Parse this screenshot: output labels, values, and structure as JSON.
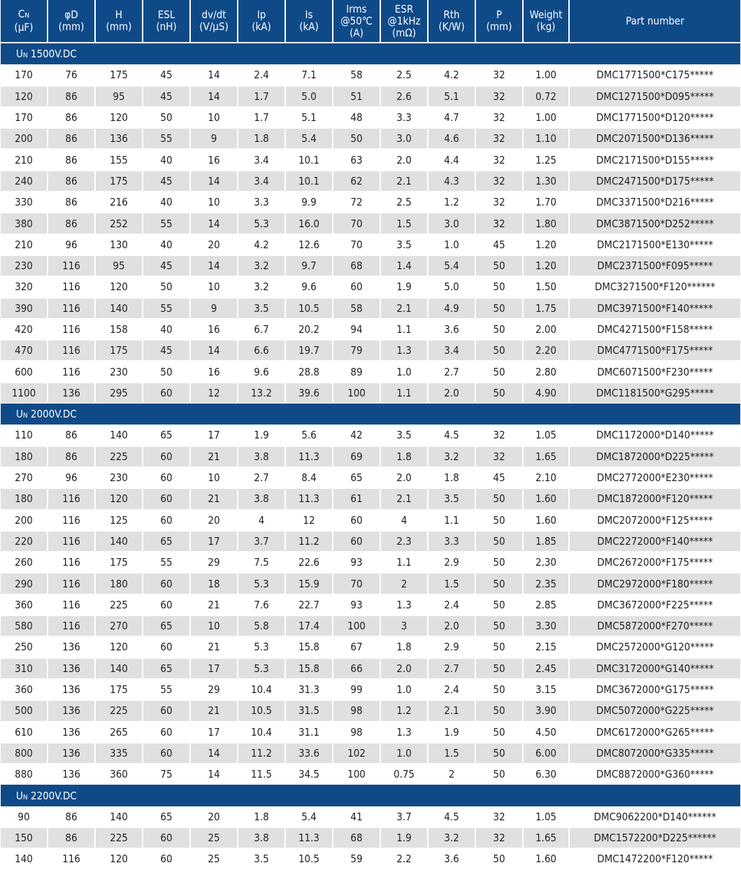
{
  "headers": [
    {
      "main": "C",
      "sub": "N",
      "unit": "(μF)"
    },
    {
      "main": "φD",
      "unit": "(mm)"
    },
    {
      "main": "H",
      "unit": "(mm)"
    },
    {
      "main": "ESL",
      "unit": "(nH)"
    },
    {
      "main": "dv/dt",
      "unit": "(V/μS)"
    },
    {
      "main": "Ip",
      "unit": "(kA)"
    },
    {
      "main": "Is",
      "unit": "(kA)"
    },
    {
      "main": "Irms",
      "line2": "@50℃",
      "unit": "(A)"
    },
    {
      "main": "ESR",
      "line2": "@1kHz",
      "unit": "(mΩ)"
    },
    {
      "main": "Rth",
      "unit": "(K/W)"
    },
    {
      "main": "P",
      "unit": "(mm)"
    },
    {
      "main": "Weight",
      "unit": "(kg)"
    },
    {
      "main": "Part number"
    }
  ],
  "sections": [
    {
      "label_prefix": "U",
      "label_sub": "N",
      "label": " 1500V.DC",
      "rows": [
        [
          "170",
          "76",
          "175",
          "45",
          "14",
          "2.4",
          "7.1",
          "58",
          "2.5",
          "4.2",
          "32",
          "1.00",
          "DMC1771500*C175*****"
        ],
        [
          "120",
          "86",
          "95",
          "45",
          "14",
          "1.7",
          "5.0",
          "51",
          "2.6",
          "5.1",
          "32",
          "0.72",
          "DMC1271500*D095*****"
        ],
        [
          "170",
          "86",
          "120",
          "50",
          "10",
          "1.7",
          "5.1",
          "48",
          "3.3",
          "4.7",
          "32",
          "1.00",
          "DMC1771500*D120*****"
        ],
        [
          "200",
          "86",
          "136",
          "55",
          "9",
          "1.8",
          "5.4",
          "50",
          "3.0",
          "4.6",
          "32",
          "1.10",
          "DMC2071500*D136*****"
        ],
        [
          "210",
          "86",
          "155",
          "40",
          "16",
          "3.4",
          "10.1",
          "63",
          "2.0",
          "4.4",
          "32",
          "1.25",
          "DMC2171500*D155*****"
        ],
        [
          "240",
          "86",
          "175",
          "45",
          "14",
          "3.4",
          "10.1",
          "62",
          "2.1",
          "4.3",
          "32",
          "1.30",
          "DMC2471500*D175*****"
        ],
        [
          "330",
          "86",
          "216",
          "40",
          "10",
          "3.3",
          "9.9",
          "72",
          "2.5",
          "1.2",
          "32",
          "1.70",
          "DMC3371500*D216*****"
        ],
        [
          "380",
          "86",
          "252",
          "55",
          "14",
          "5.3",
          "16.0",
          "70",
          "1.5",
          "3.0",
          "32",
          "1.80",
          "DMC3871500*D252*****"
        ],
        [
          "210",
          "96",
          "130",
          "40",
          "20",
          "4.2",
          "12.6",
          "70",
          "3.5",
          "1.0",
          "45",
          "1.20",
          "DMC2171500*E130*****"
        ],
        [
          "230",
          "116",
          "95",
          "45",
          "14",
          "3.2",
          "9.7",
          "68",
          "1.4",
          "5.4",
          "50",
          "1.20",
          "DMC2371500*F095*****"
        ],
        [
          "320",
          "116",
          "120",
          "50",
          "10",
          "3.2",
          "9.6",
          "60",
          "1.9",
          "5.0",
          "50",
          "1.50",
          "DMC3271500*F120******"
        ],
        [
          "390",
          "116",
          "140",
          "55",
          "9",
          "3.5",
          "10.5",
          "58",
          "2.1",
          "4.9",
          "50",
          "1.75",
          "DMC3971500*F140*****"
        ],
        [
          "420",
          "116",
          "158",
          "40",
          "16",
          "6.7",
          "20.2",
          "94",
          "1.1",
          "3.6",
          "50",
          "2.00",
          "DMC4271500*F158*****"
        ],
        [
          "470",
          "116",
          "175",
          "45",
          "14",
          "6.6",
          "19.7",
          "79",
          "1.3",
          "3.4",
          "50",
          "2.20",
          "DMC4771500*F175*****"
        ],
        [
          "600",
          "116",
          "230",
          "50",
          "16",
          "9.6",
          "28.8",
          "89",
          "1.0",
          "2.7",
          "50",
          "2.80",
          "DMC6071500*F230*****"
        ],
        [
          "1100",
          "136",
          "295",
          "60",
          "12",
          "13.2",
          "39.6",
          "100",
          "1.1",
          "2.0",
          "50",
          "4.90",
          "DMC1181500*G295*****"
        ]
      ]
    },
    {
      "label_prefix": "U",
      "label_sub": "N",
      "label": " 2000V.DC",
      "rows": [
        [
          "110",
          "86",
          "140",
          "65",
          "17",
          "1.9",
          "5.6",
          "42",
          "3.5",
          "4.5",
          "32",
          "1.05",
          "DMC1172000*D140*****"
        ],
        [
          "180",
          "86",
          "225",
          "60",
          "21",
          "3.8",
          "11.3",
          "69",
          "1.8",
          "3.2",
          "32",
          "1.65",
          "DMC1872000*D225*****"
        ],
        [
          "270",
          "96",
          "230",
          "60",
          "10",
          "2.7",
          "8.4",
          "65",
          "2.0",
          "1.8",
          "45",
          "2.10",
          "DMC2772000*E230*****"
        ],
        [
          "180",
          "116",
          "120",
          "60",
          "21",
          "3.8",
          "11.3",
          "61",
          "2.1",
          "3.5",
          "50",
          "1.60",
          "DMC1872000*F120*****"
        ],
        [
          "200",
          "116",
          "125",
          "60",
          "20",
          "4",
          "12",
          "60",
          "4",
          "1.1",
          "50",
          "1.60",
          "DMC2072000*F125*****"
        ],
        [
          "220",
          "116",
          "140",
          "65",
          "17",
          "3.7",
          "11.2",
          "60",
          "2.3",
          "3.3",
          "50",
          "1.85",
          "DMC2272000*F140*****"
        ],
        [
          "260",
          "116",
          "175",
          "55",
          "29",
          "7.5",
          "22.6",
          "93",
          "1.1",
          "2.9",
          "50",
          "2.30",
          "DMC2672000*F175*****"
        ],
        [
          "290",
          "116",
          "180",
          "60",
          "18",
          "5.3",
          "15.9",
          "70",
          "2",
          "1.5",
          "50",
          "2.35",
          "DMC2972000*F180*****"
        ],
        [
          "360",
          "116",
          "225",
          "60",
          "21",
          "7.6",
          "22.7",
          "93",
          "1.3",
          "2.4",
          "50",
          "2.85",
          "DMC3672000*F225*****"
        ],
        [
          "580",
          "116",
          "270",
          "65",
          "10",
          "5.8",
          "17.4",
          "100",
          "3",
          "2.0",
          "50",
          "3.30",
          "DMC5872000*F270*****"
        ],
        [
          "250",
          "136",
          "120",
          "60",
          "21",
          "5.3",
          "15.8",
          "67",
          "1.8",
          "2.9",
          "50",
          "2.15",
          "DMC2572000*G120*****"
        ],
        [
          "310",
          "136",
          "140",
          "65",
          "17",
          "5.3",
          "15.8",
          "66",
          "2.0",
          "2.7",
          "50",
          "2.45",
          "DMC3172000*G140*****"
        ],
        [
          "360",
          "136",
          "175",
          "55",
          "29",
          "10.4",
          "31.3",
          "99",
          "1.0",
          "2.4",
          "50",
          "3.15",
          "DMC3672000*G175*****"
        ],
        [
          "500",
          "136",
          "225",
          "60",
          "21",
          "10.5",
          "31.5",
          "98",
          "1.2",
          "2.1",
          "50",
          "3.90",
          "DMC5072000*G225*****"
        ],
        [
          "610",
          "136",
          "265",
          "60",
          "17",
          "10.4",
          "31.1",
          "98",
          "1.3",
          "1.9",
          "50",
          "4.50",
          "DMC6172000*G265*****"
        ],
        [
          "800",
          "136",
          "335",
          "60",
          "14",
          "11.2",
          "33.6",
          "102",
          "1.0",
          "1.5",
          "50",
          "6.00",
          "DMC8072000*G335*****"
        ],
        [
          "880",
          "136",
          "360",
          "75",
          "14",
          "11.5",
          "34.5",
          "100",
          "0.75",
          "2",
          "50",
          "6.30",
          "DMC8872000*G360*****"
        ]
      ]
    },
    {
      "label_prefix": "U",
      "label_sub": "N",
      "label": " 2200V.DC",
      "rows": [
        [
          "90",
          "86",
          "140",
          "65",
          "20",
          "1.8",
          "5.4",
          "41",
          "3.7",
          "4.5",
          "32",
          "1.05",
          "DMC9062200*D140******"
        ],
        [
          "150",
          "86",
          "225",
          "60",
          "25",
          "3.8",
          "11.3",
          "68",
          "1.9",
          "3.2",
          "32",
          "1.65",
          "DMC1572200*D225******"
        ],
        [
          "140",
          "116",
          "120",
          "60",
          "25",
          "3.5",
          "10.5",
          "59",
          "2.2",
          "3.6",
          "50",
          "1.60",
          "DMC1472200*F120*****"
        ]
      ]
    }
  ],
  "colors": {
    "header_bg": "#0f4a88",
    "alt_row": "#e0e0e0"
  }
}
